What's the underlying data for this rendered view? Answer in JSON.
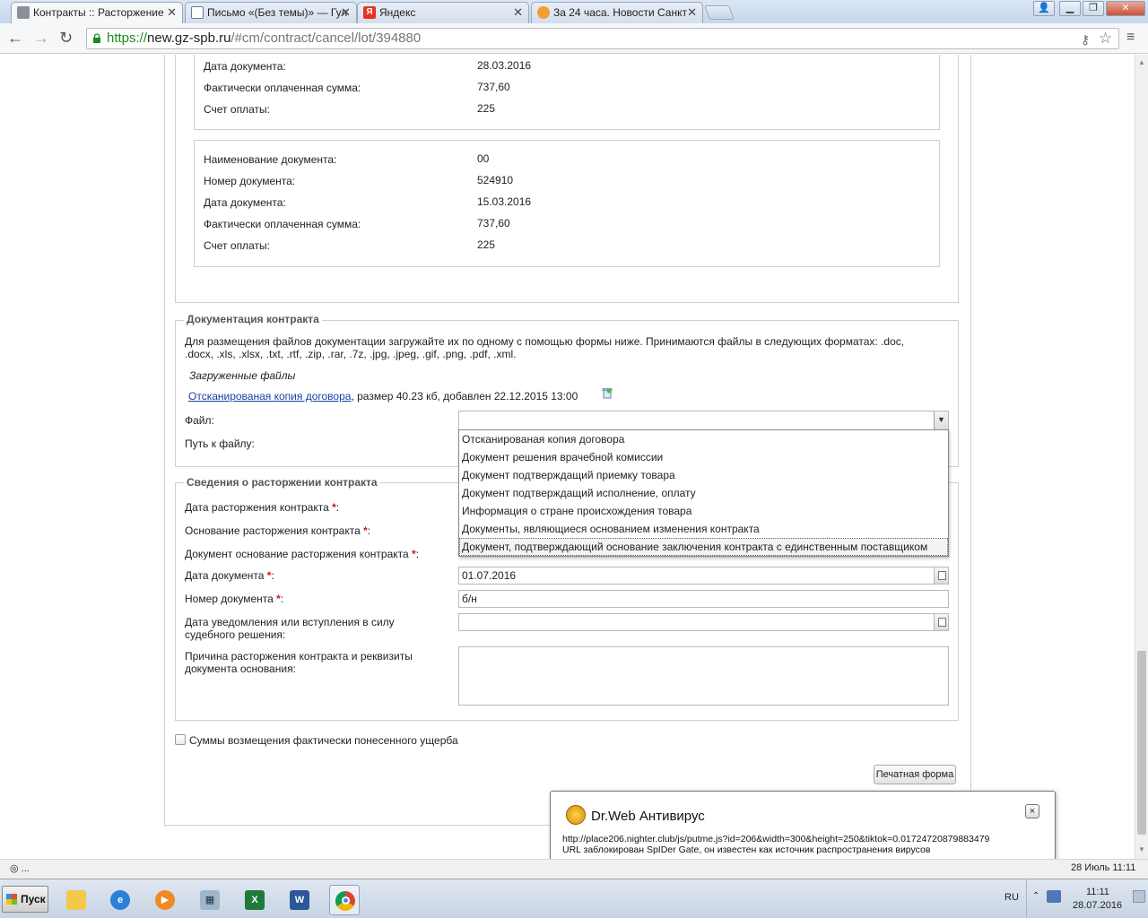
{
  "browser": {
    "tabs": [
      {
        "label": "Контракты :: Расторжение",
        "active": true,
        "icon": "wrench-icon"
      },
      {
        "label": "Письмо «(Без темы)» — Гул",
        "active": false,
        "icon": "mail-icon"
      },
      {
        "label": "Яндекс",
        "active": false,
        "icon": "yandex-icon"
      },
      {
        "label": "За 24 часа. Новости Санкт",
        "active": false,
        "icon": "news-icon"
      }
    ],
    "url": {
      "scheme": "https://",
      "host": "new.gz-spb.ru",
      "path": "/#cm/contract/cancel/lot/394880"
    }
  },
  "payments": {
    "partial": [
      {
        "label": "Дата документа:",
        "value": "28.03.2016"
      },
      {
        "label": "Фактически оплаченная сумма:",
        "value": "737,60"
      },
      {
        "label": "Счет оплаты:",
        "value": "225"
      }
    ],
    "full": [
      {
        "label": "Наименование документа:",
        "value": "00"
      },
      {
        "label": "Номер документа:",
        "value": "524910"
      },
      {
        "label": "Дата документа:",
        "value": "15.03.2016"
      },
      {
        "label": "Фактически оплаченная сумма:",
        "value": "737,60"
      },
      {
        "label": "Счет оплаты:",
        "value": "225"
      }
    ]
  },
  "documentation": {
    "legend": "Документация контракта",
    "hint_line1": "Для размещения файлов документации загружайте их по одному с помощью формы ниже. Принимаются файлы в следующих форматах: .doc,",
    "hint_line2": ".docx, .xls, .xlsx, .txt, .rtf, .zip, .rar, .7z, .jpg, .jpeg, .gif, .png, .pdf, .xml.",
    "uploaded_title": "Загруженные файлы",
    "file_link": "Отсканированая копия договора",
    "file_meta": ", размер 40.23 кб, добавлен 22.12.2015 13:00",
    "file_label": "Файл:",
    "path_label": "Путь к файлу:",
    "file_options": [
      "Отсканированая копия договора",
      "Документ решения врачебной комиссии",
      "Документ подтверждащий приемку товара",
      "Документ подтверждащий исполнение, оплату",
      "Информация о стране происхождения товара",
      "Документы, являющиеся основанием изменения контракта",
      "Документ, подтверждающий основание заключения контракта с единственным поставщиком"
    ]
  },
  "termination": {
    "legend": "Сведения о расторжении контракта",
    "date_label": "Дата расторжения контракта",
    "basis_label": "Основание расторжения контракта",
    "doc_basis_label": "Документ основание расторжения контракта",
    "doc_date_label": "Дата документа",
    "doc_date_value": "01.07.2016",
    "doc_number_label": "Номер документа",
    "doc_number_value": "б/н",
    "notice_date_label_1": "Дата уведомления или вступления в силу",
    "notice_date_label_2": "судебного решения:",
    "reason_label_1": "Причина расторжения контракта и реквизиты",
    "reason_label_2": "документа основания:",
    "req_mark": "*",
    "colon": ":"
  },
  "damages_checkbox_label": "Суммы возмещения фактически понесенного ущерба",
  "print_button": "Печатная форма",
  "drweb": {
    "title": "Dr.Web Антивирус",
    "url": "http://place206.nighter.club/js/putme.js?id=206&width=300&height=250&tiktok=0.01724720879883479",
    "message": "URL заблокирован SpIDer Gate, он известен как источник распространения вирусов",
    "close": "×"
  },
  "statusbar": {
    "left": "◎ ...",
    "right": "28 Июль 11:11"
  },
  "taskbar": {
    "start": "Пуск",
    "lang": "RU",
    "time": "11:11",
    "date": "28.07.2016",
    "apps": [
      "explorer-folder-icon",
      "internet-explorer-icon",
      "media-player-icon",
      "calculator-icon",
      "excel-icon",
      "word-icon",
      "chrome-icon"
    ]
  }
}
